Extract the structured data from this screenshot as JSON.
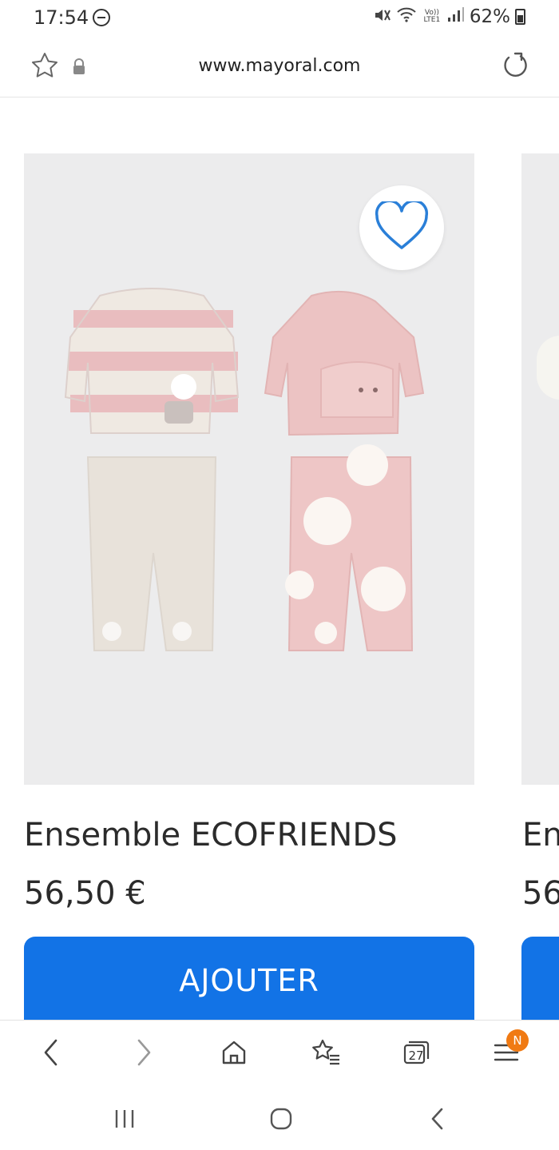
{
  "status_bar": {
    "time": "17:54",
    "network_label": "Vo)) LTE1",
    "battery": "62%"
  },
  "url_bar": {
    "url": "www.mayoral.com"
  },
  "product": {
    "title": "Ensemble ECOFRIENDS",
    "price": "56,50 €",
    "add_button_label": "AJOUTER",
    "favorite": false
  },
  "next_product": {
    "title_partial": "En",
    "price_partial": "56"
  },
  "toolbar": {
    "tab_count": "27",
    "menu_badge": "N"
  },
  "colors": {
    "accent": "#1273e6",
    "heart": "#2a7fd8",
    "badge": "#f07a13"
  }
}
